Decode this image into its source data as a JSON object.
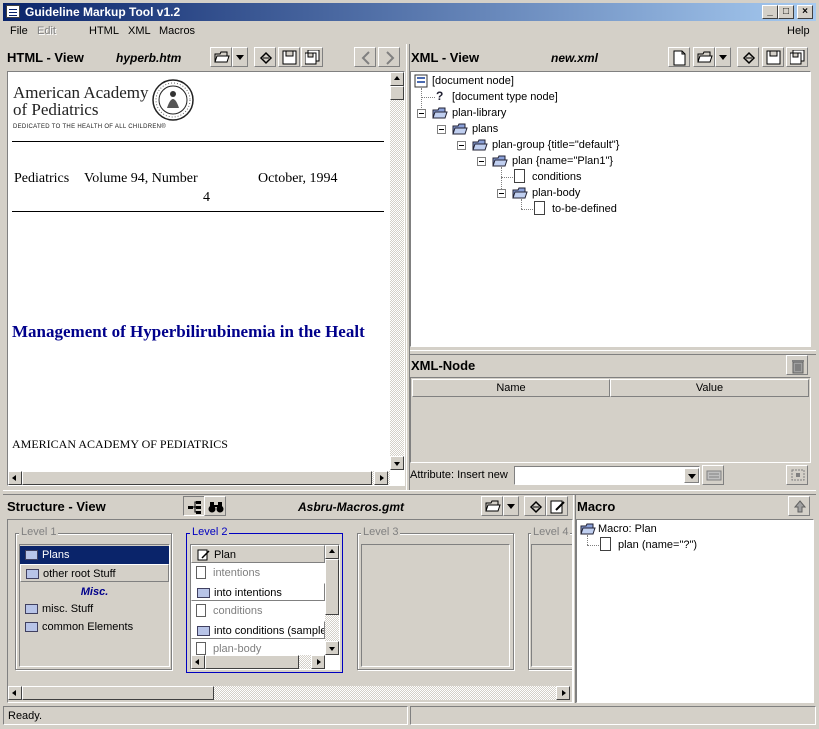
{
  "window": {
    "title": "Guideline Markup Tool v1.2"
  },
  "menu": {
    "file": "File",
    "edit": "Edit",
    "html": "HTML",
    "xml": "XML",
    "macros": "Macros",
    "help": "Help"
  },
  "html_view": {
    "header": "HTML - View",
    "filename": "hyperb.htm",
    "logo_line1": "American Academy",
    "logo_line2": "of Pediatrics",
    "logo_tagline": "DEDICATED TO THE HEALTH OF ALL CHILDREN®",
    "journal": "Pediatrics",
    "volume": "Volume 94, Number",
    "number": "4",
    "date": "October, 1994",
    "headline": "Management of Hyperbilirubinemia in the Healt",
    "author": "AMERICAN ACADEMY OF PEDIATRICS"
  },
  "xml_view": {
    "header": "XML - View",
    "filename": "new.xml",
    "tree": {
      "document_node": "[document node]",
      "doctype_node": "[document type node]",
      "plan_library": "plan-library",
      "plans": "plans",
      "plan_group": "plan-group {title=\"default\"}",
      "plan": "plan {name=\"Plan1\"}",
      "conditions": "conditions",
      "plan_body": "plan-body",
      "to_be_defined": "to-be-defined"
    }
  },
  "xml_node": {
    "header": "XML-Node",
    "col_name": "Name",
    "col_value": "Value",
    "attribute_label": "Attribute: Insert new",
    "attribute_value": ""
  },
  "structure_view": {
    "header": "Structure - View",
    "filename": "Asbru-Macros.gmt",
    "level1": {
      "title": "Level 1",
      "items": [
        "Plans",
        "other root Stuff"
      ],
      "misc_header": "Misc.",
      "misc_items": [
        "misc. Stuff",
        "common Elements"
      ]
    },
    "level2": {
      "title": "Level 2",
      "header_item": "Plan",
      "items": [
        "intentions",
        "into intentions",
        "conditions",
        "into conditions (samples",
        "plan-body"
      ]
    },
    "level3": {
      "title": "Level 3"
    },
    "level4": {
      "title": "Level 4"
    }
  },
  "macro": {
    "header": "Macro",
    "root": "Macro: Plan",
    "child": "plan (name=\"?\")"
  },
  "status": {
    "text": "Ready."
  },
  "colors": {
    "title_start": "#0a246a",
    "title_end": "#a6caf0",
    "selection": "#0a246a",
    "headline": "#00008b"
  }
}
